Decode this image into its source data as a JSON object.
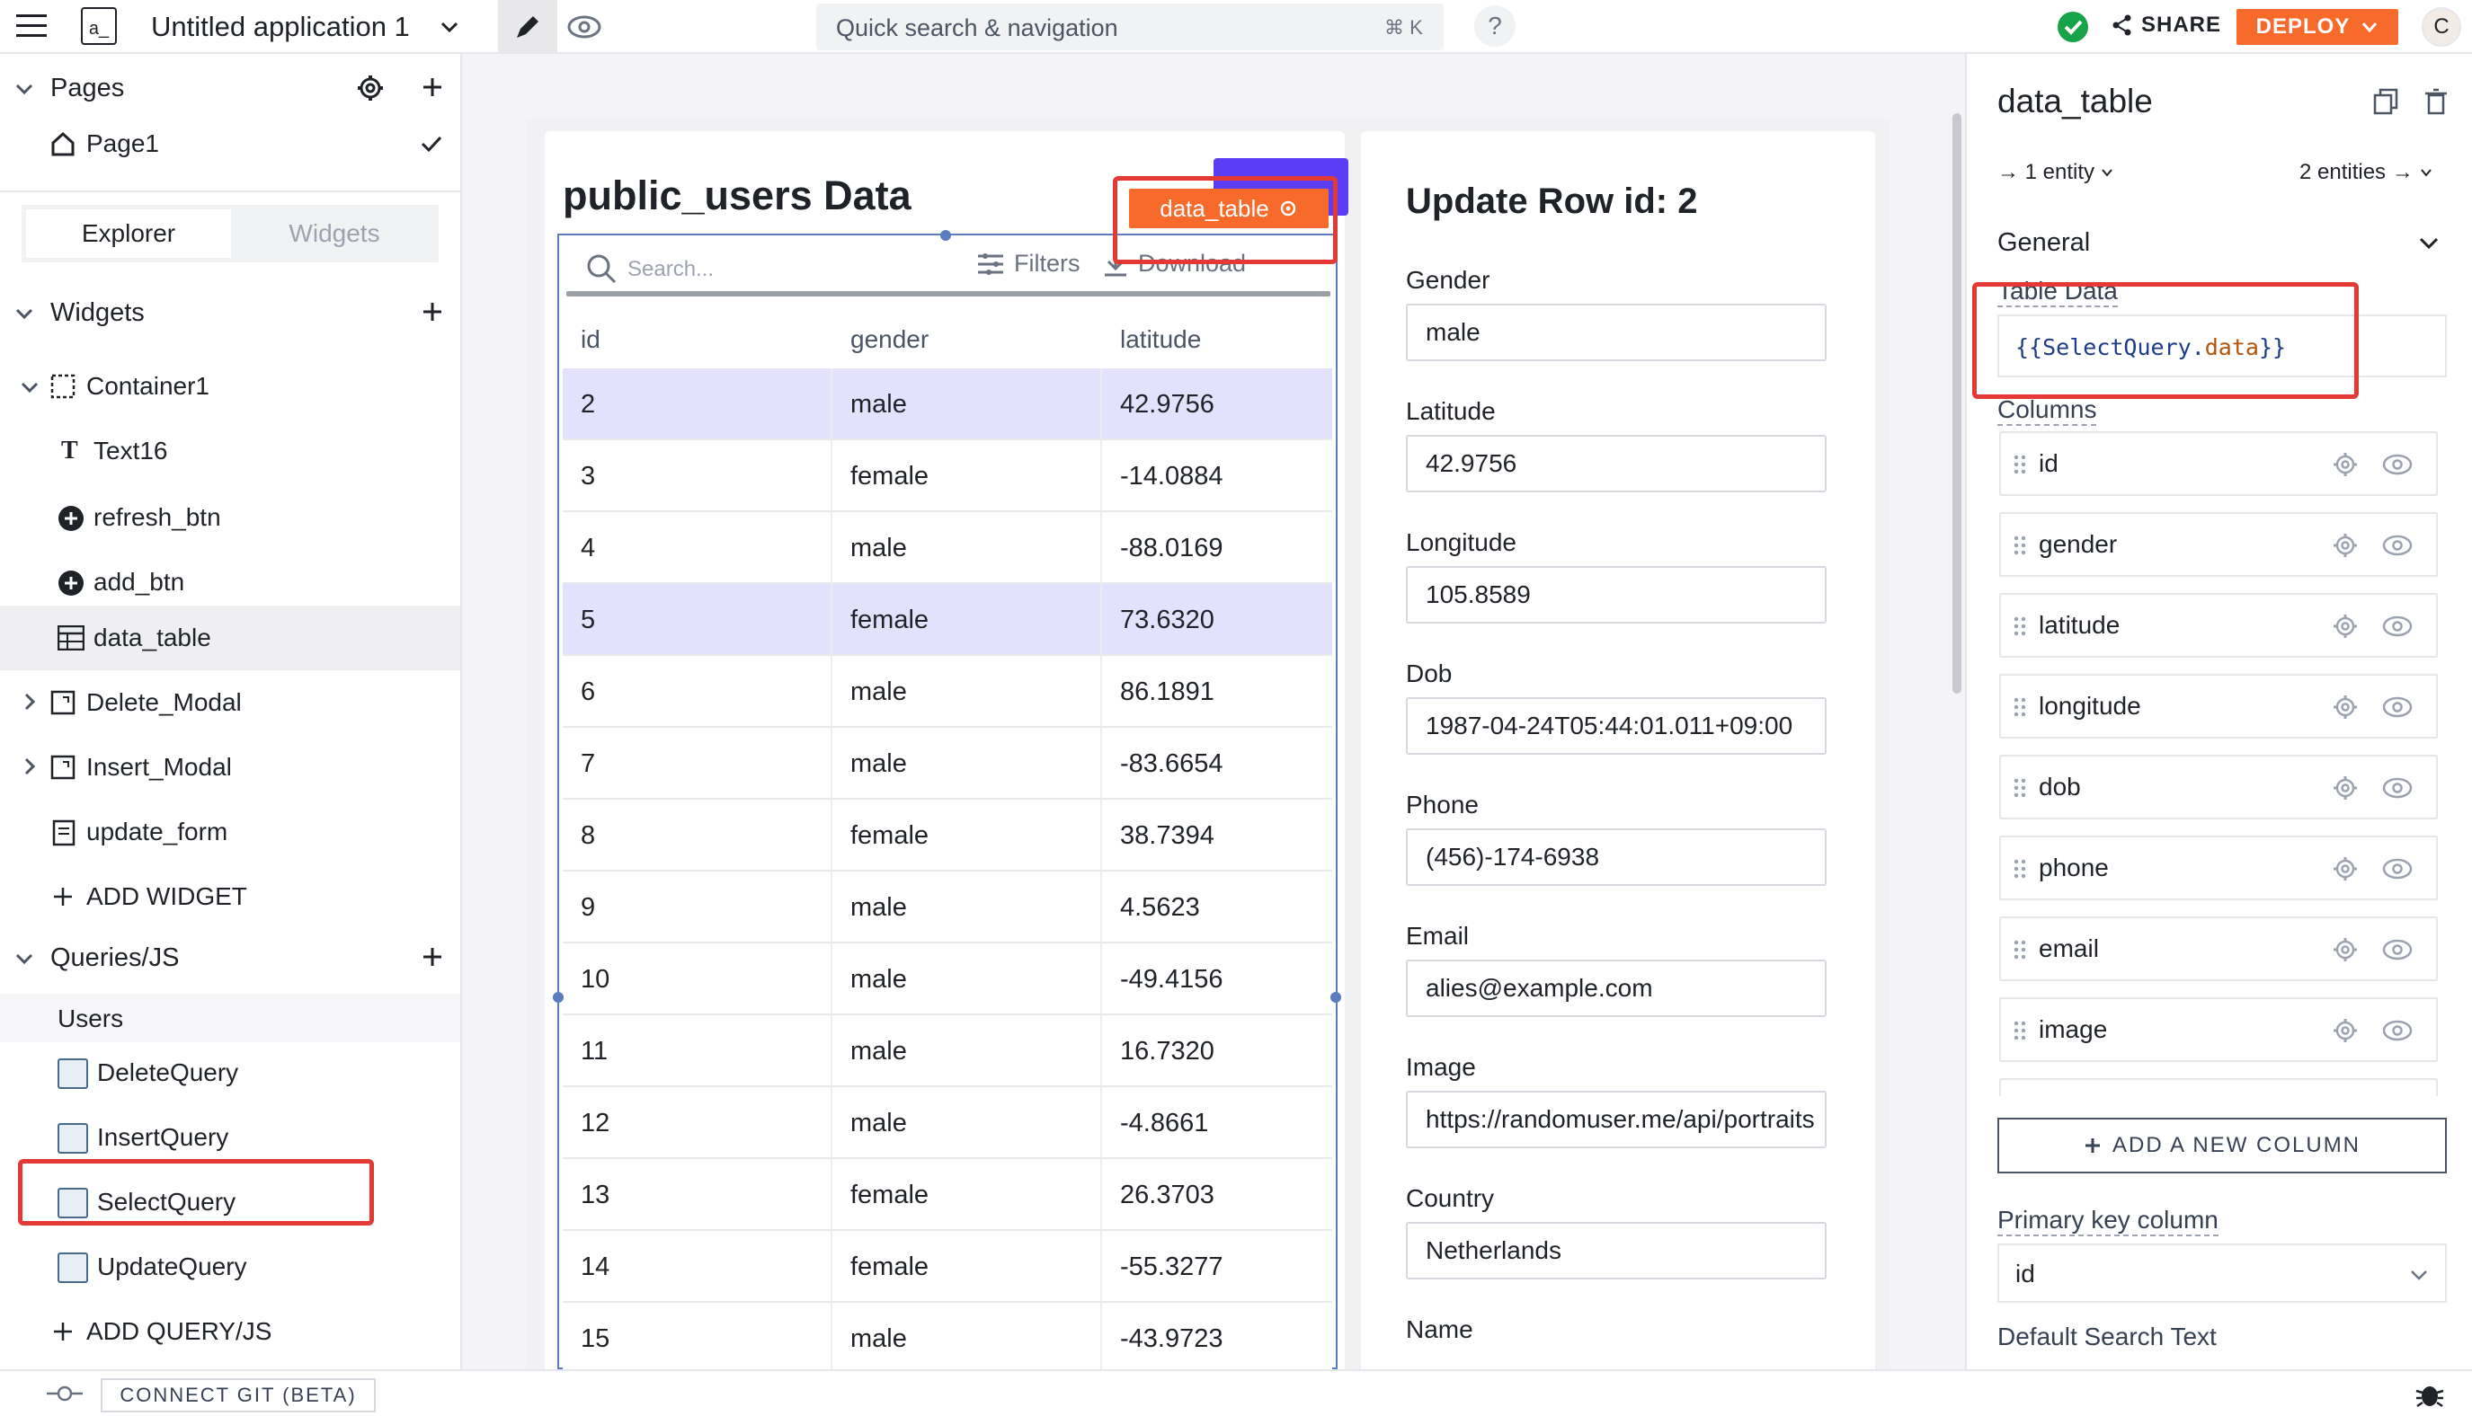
{
  "header": {
    "logo_text": "a_",
    "app_title": "Untitled application 1",
    "search_placeholder": "Quick search & navigation",
    "search_shortcut": "⌘ K",
    "help_symbol": "?",
    "share_label": "SHARE",
    "deploy_label": "DEPLOY",
    "avatar_initial": "C"
  },
  "sidebar": {
    "pages_title": "Pages",
    "page1": "Page1",
    "tab_explorer": "Explorer",
    "tab_widgets": "Widgets",
    "widgets_title": "Widgets",
    "container": "Container1",
    "text16": "Text16",
    "refresh_btn": "refresh_btn",
    "add_btn": "add_btn",
    "data_table": "data_table",
    "delete_modal": "Delete_Modal",
    "insert_modal": "Insert_Modal",
    "update_form": "update_form",
    "add_widget": "ADD WIDGET",
    "queries_title": "Queries/JS",
    "users_group": "Users",
    "q_delete": "DeleteQuery",
    "q_insert": "InsertQuery",
    "q_select": "SelectQuery",
    "q_update": "UpdateQuery",
    "add_query": "ADD QUERY/JS"
  },
  "canvas": {
    "table_title": "public_users Data",
    "widget_tag": "data_table",
    "search_placeholder": "Search...",
    "filters_label": "Filters",
    "download_label": "Download",
    "columns": [
      "id",
      "gender",
      "latitude"
    ],
    "rows": [
      [
        "2",
        "male",
        "42.9756"
      ],
      [
        "3",
        "female",
        "-14.0884"
      ],
      [
        "4",
        "male",
        "-88.0169"
      ],
      [
        "5",
        "female",
        "73.6320"
      ],
      [
        "6",
        "male",
        "86.1891"
      ],
      [
        "7",
        "male",
        "-83.6654"
      ],
      [
        "8",
        "female",
        "38.7394"
      ],
      [
        "9",
        "male",
        "4.5623"
      ],
      [
        "10",
        "male",
        "-49.4156"
      ],
      [
        "11",
        "male",
        "16.7320"
      ],
      [
        "12",
        "male",
        "-4.8661"
      ],
      [
        "13",
        "female",
        "26.3703"
      ],
      [
        "14",
        "female",
        "-55.3277"
      ],
      [
        "15",
        "male",
        "-43.9723"
      ]
    ],
    "highlighted_rows": [
      "2",
      "5"
    ],
    "form_title": "Update Row id: 2",
    "form_fields": [
      {
        "label": "Gender",
        "value": "male"
      },
      {
        "label": "Latitude",
        "value": "42.9756"
      },
      {
        "label": "Longitude",
        "value": "105.8589"
      },
      {
        "label": "Dob",
        "value": "1987-04-24T05:44:01.011+09:00"
      },
      {
        "label": "Phone",
        "value": "(456)-174-6938"
      },
      {
        "label": "Email",
        "value": "alies@example.com"
      },
      {
        "label": "Image",
        "value": "https://randomuser.me/api/portraits"
      },
      {
        "label": "Country",
        "value": "Netherlands"
      },
      {
        "label": "Name",
        "value": ""
      }
    ]
  },
  "properties": {
    "widget_name": "data_table",
    "entity_in": "→ 1 entity",
    "entity_out": "2 entities →",
    "section_general": "General",
    "table_data_label": "Table Data",
    "table_data_open": "{{",
    "table_data_obj": "SelectQuery",
    "table_data_dot": ".",
    "table_data_prop": "data",
    "table_data_close": "}}",
    "columns_label": "Columns",
    "columns": [
      "id",
      "gender",
      "latitude",
      "longitude",
      "dob",
      "phone",
      "email",
      "image"
    ],
    "add_column": "ADD A NEW COLUMN",
    "primary_key_label": "Primary key column",
    "primary_key_value": "id",
    "default_search_label": "Default Search Text"
  },
  "footer": {
    "connect_git": "CONNECT GIT (BETA)"
  },
  "colors": {
    "brand_orange": "#f86a2b",
    "highlight_row": "#e3e1fb",
    "annotation_red": "#e53935",
    "success_green": "#16a34a",
    "purple_toolbar": "#5b3df5"
  }
}
